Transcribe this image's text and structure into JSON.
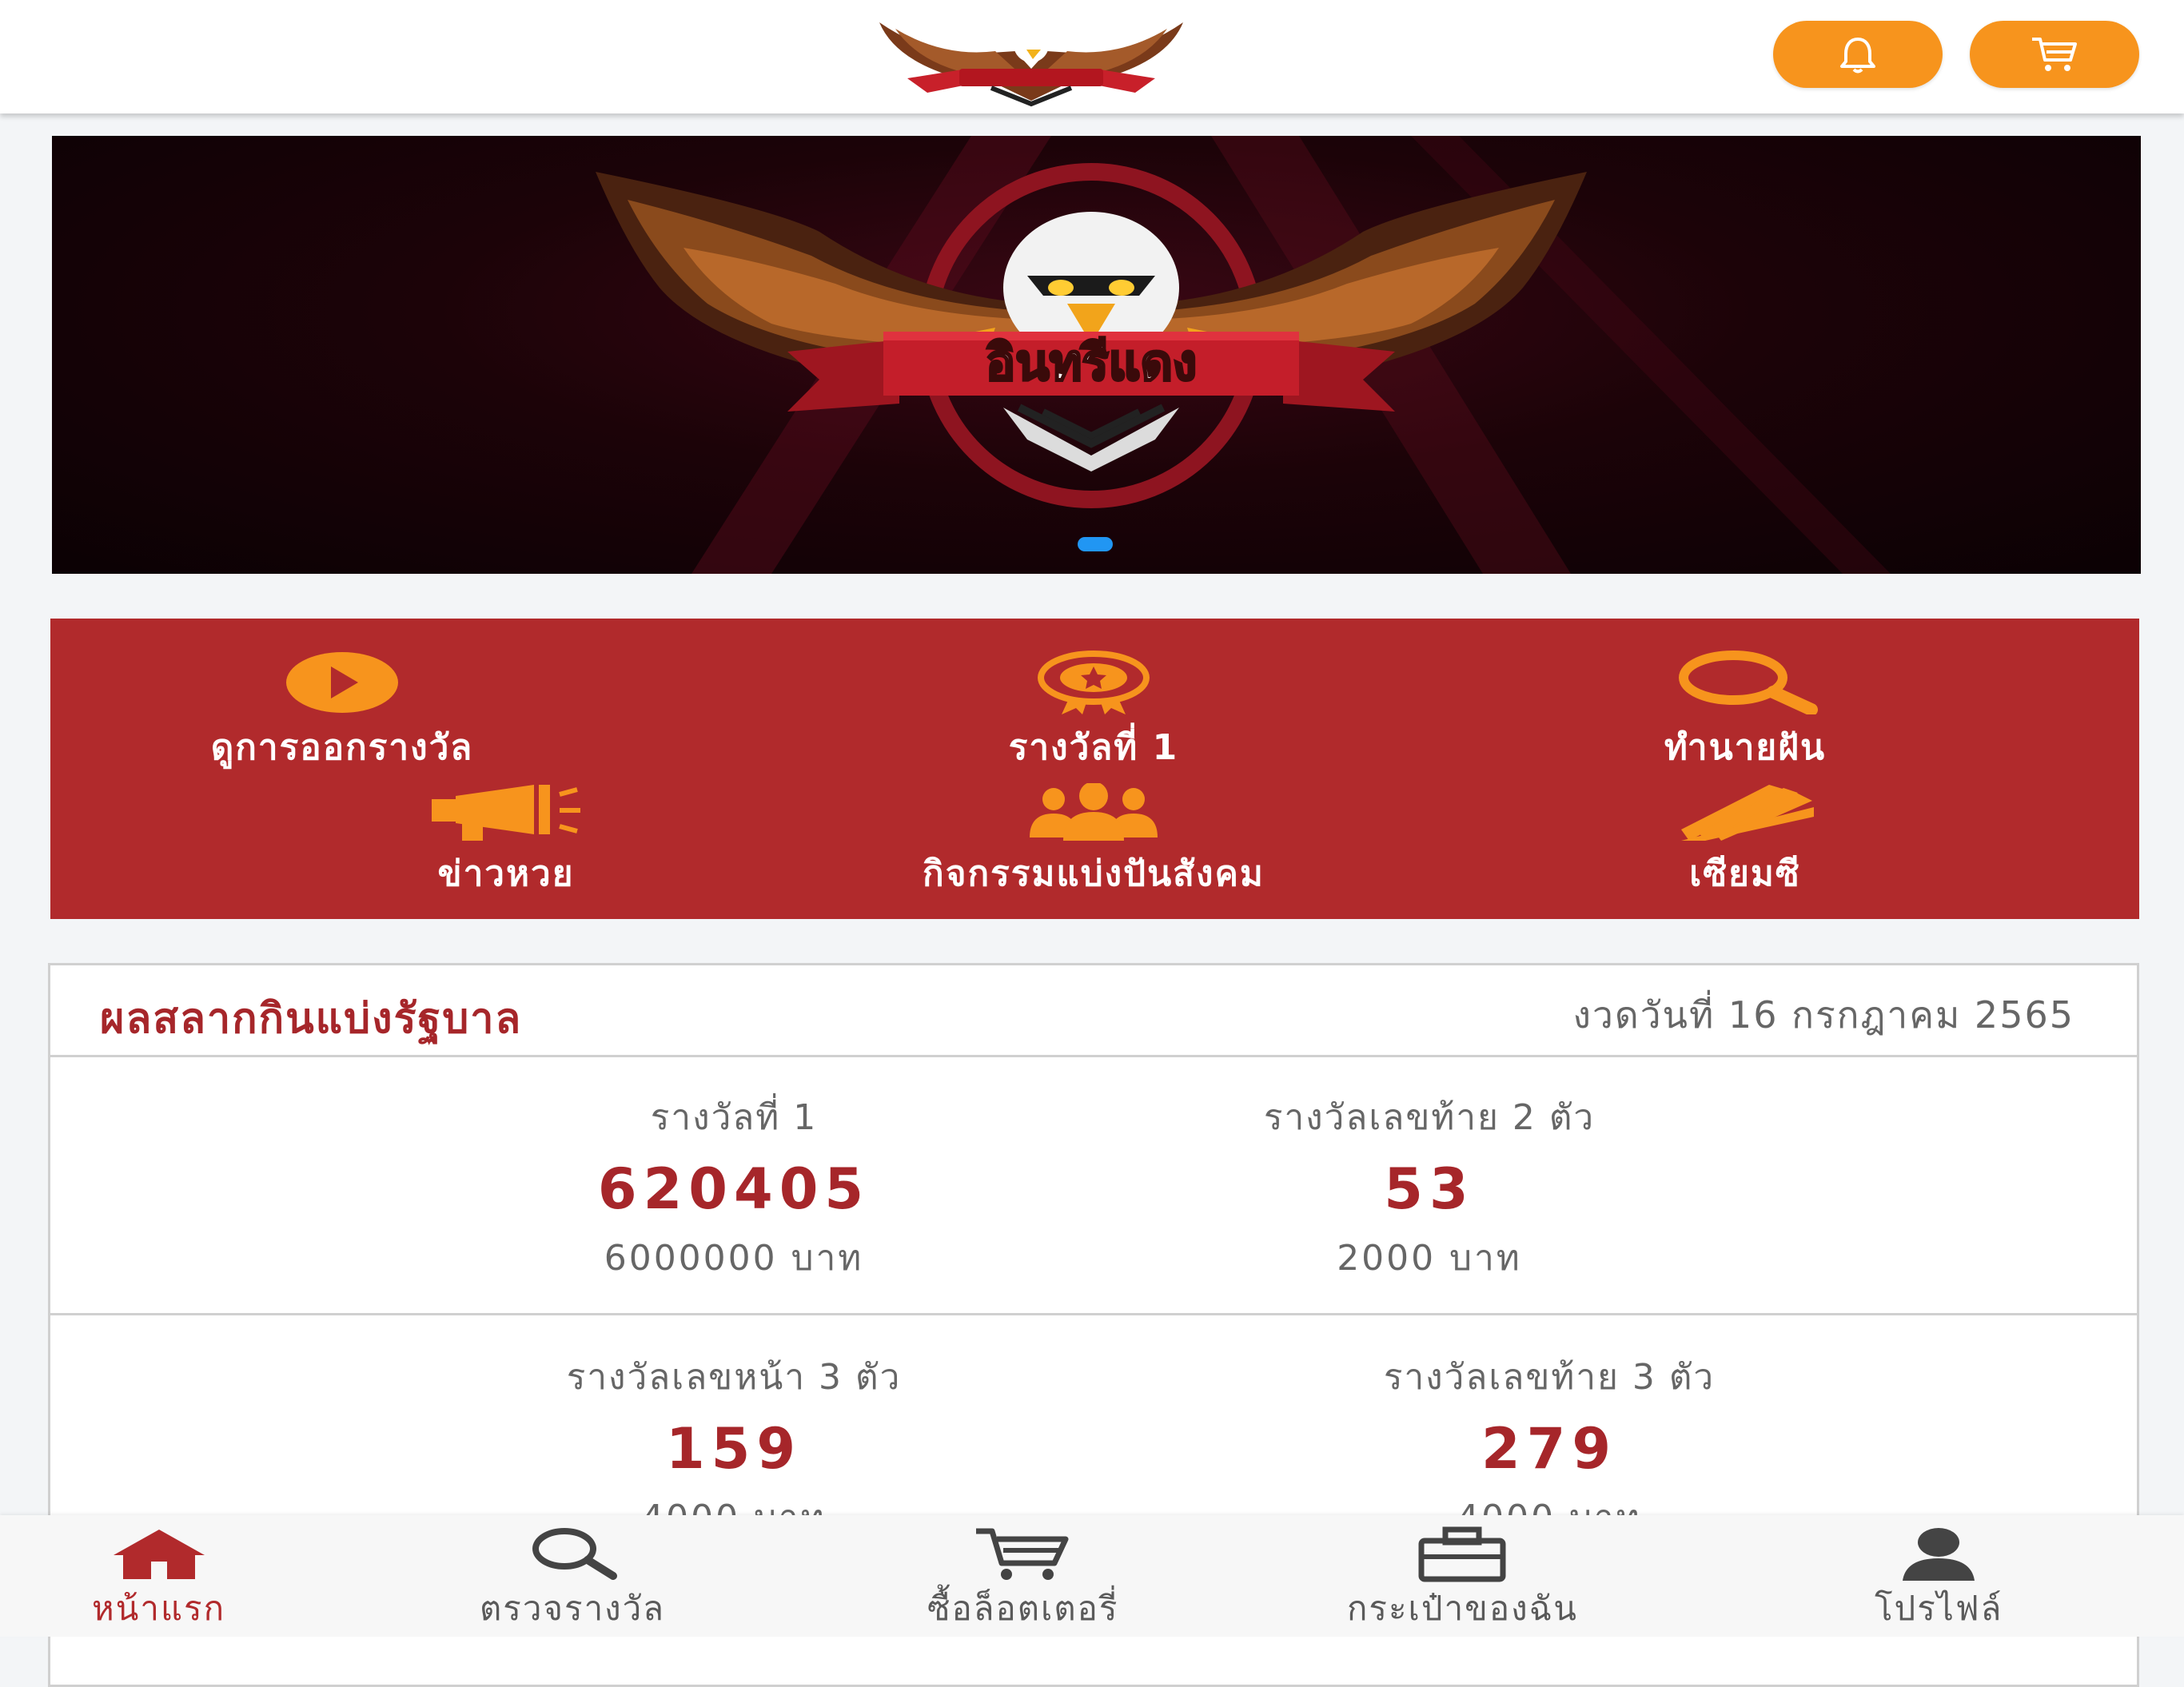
{
  "header": {
    "logo_icon": "eagle-logo",
    "bell_icon": "bell-icon",
    "cart_icon": "cart-icon",
    "accent_color": "#f7941d"
  },
  "banner": {
    "brand_text": "อินทรีแดง",
    "slide_count": 1,
    "active_slide": 1
  },
  "quick_menu": {
    "items": [
      {
        "label": "ดูการออกรางวัล",
        "icon": "play-icon"
      },
      {
        "label": "รางวัลที่ 1",
        "icon": "award-icon"
      },
      {
        "label": "ทำนายฝัน",
        "icon": "search-icon"
      },
      {
        "label": "ข่าวหวย",
        "icon": "megaphone-icon"
      },
      {
        "label": "กิจกรรมแบ่งปันสังคม",
        "icon": "people-icon"
      },
      {
        "label": "เซียมซี",
        "icon": "fortune-sticks-icon"
      }
    ],
    "background_color": "#b12a2c"
  },
  "results": {
    "title": "ผลสลากกินแบ่งรัฐบาล",
    "date": "งวดวันที่ 16 กรกฎาคม 2565",
    "prizes": [
      {
        "label": "รางวัลที่ 1",
        "number": "620405",
        "amount": "6000000 บาท"
      },
      {
        "label": "รางวัลเลขท้าย 2 ตัว",
        "number": "53",
        "amount": "2000 บาท"
      },
      {
        "label": "รางวัลเลขหน้า 3 ตัว",
        "number": "159",
        "amount": "4000 บาท"
      },
      {
        "label": "รางวัลเลขท้าย 3 ตัว",
        "number": "279",
        "amount": "4000 บาท"
      }
    ]
  },
  "bottom_nav": {
    "items": [
      {
        "label": "หน้าแรก",
        "icon": "home-icon",
        "active": true
      },
      {
        "label": "ตรวจรางวัล",
        "icon": "search-icon",
        "active": false
      },
      {
        "label": "ซื้อล็อตเตอรี่",
        "icon": "cart-icon",
        "active": false
      },
      {
        "label": "กระเป๋าของฉัน",
        "icon": "wallet-icon",
        "active": false
      },
      {
        "label": "โปรไฟล์",
        "icon": "user-icon",
        "active": false
      }
    ],
    "active_color": "#b12a2c"
  }
}
